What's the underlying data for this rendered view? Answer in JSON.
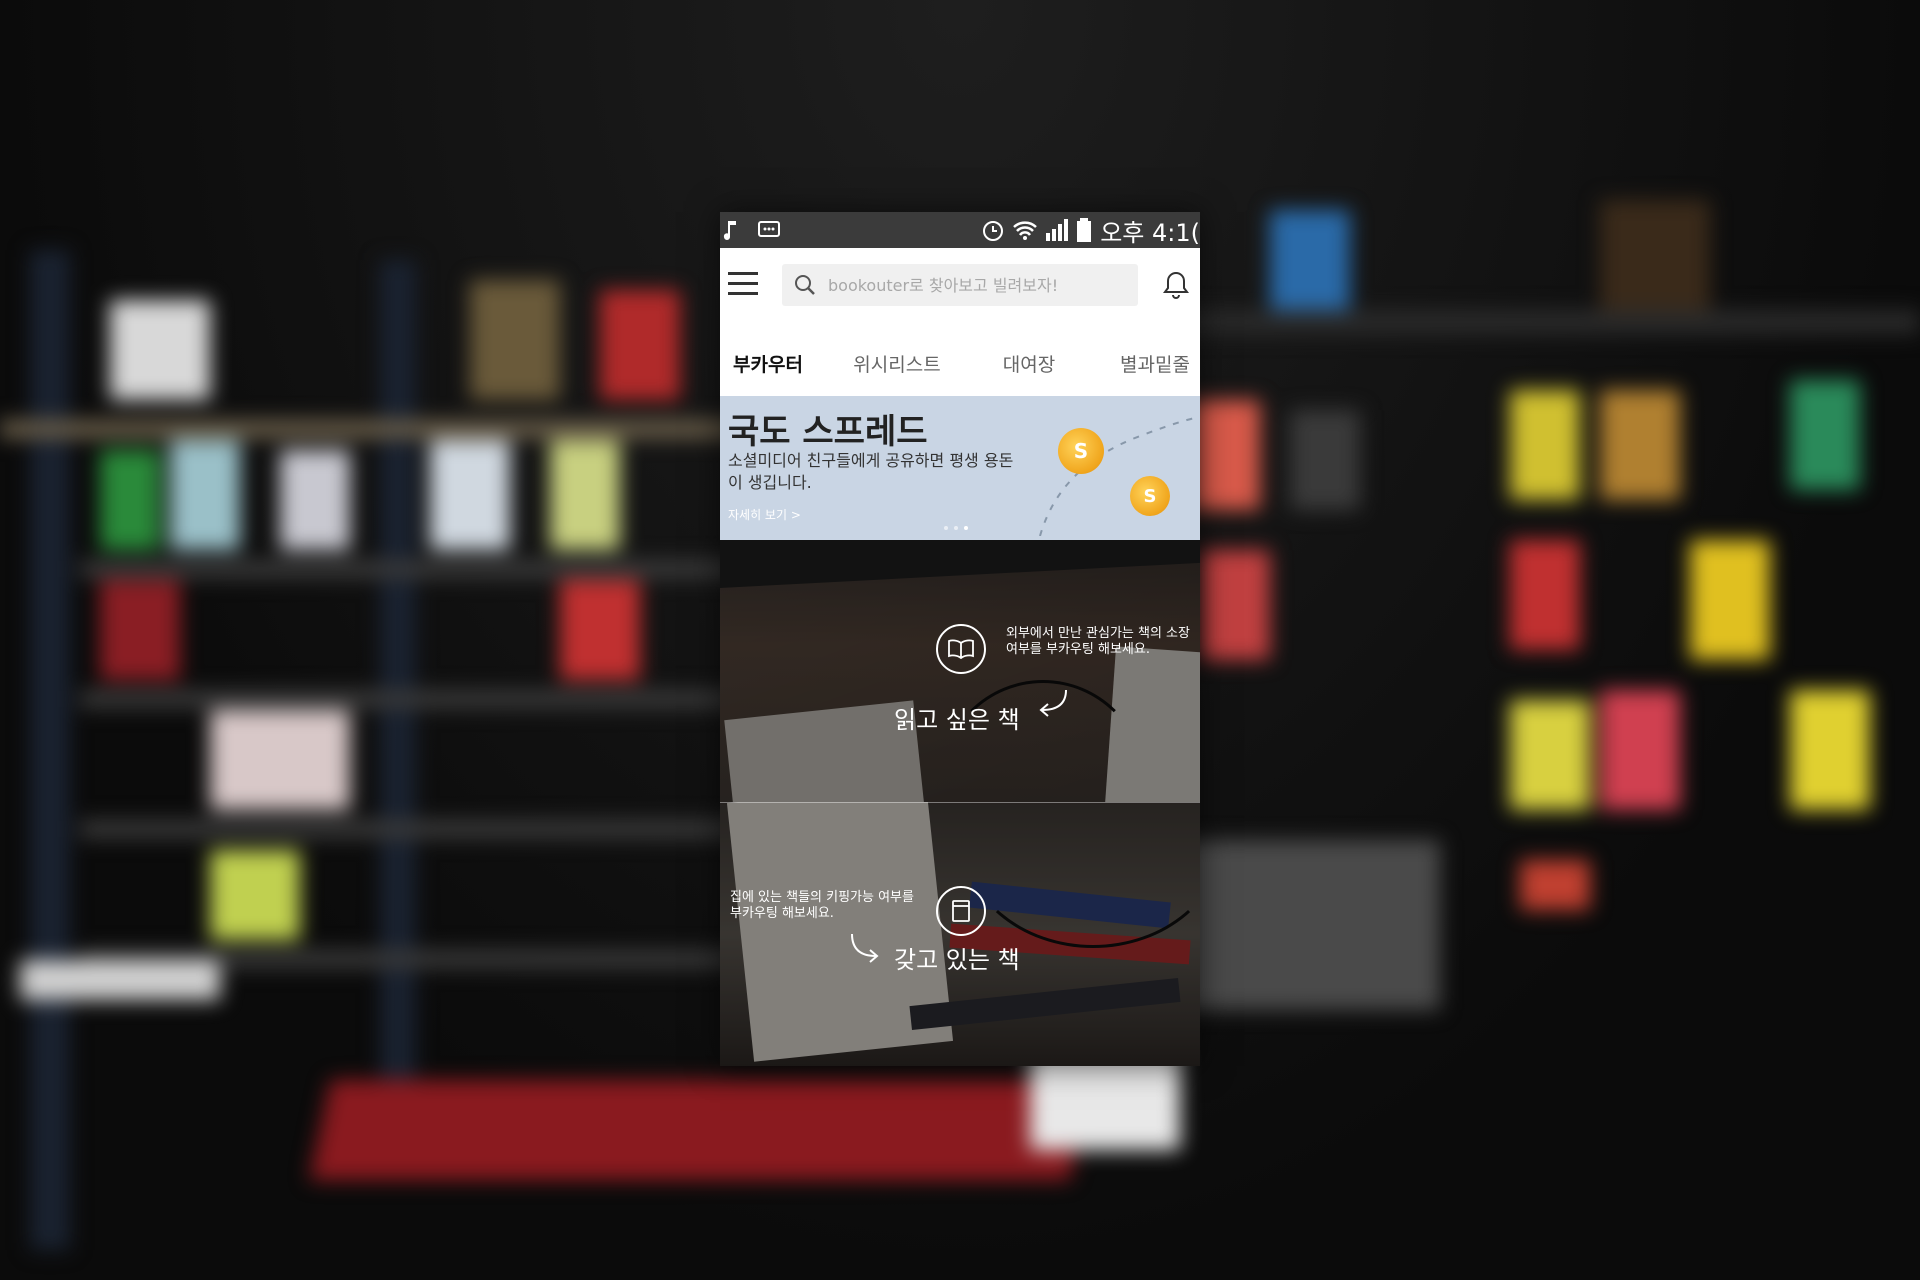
{
  "statusbar": {
    "left_icons": [
      "music-note-icon",
      "message-icon"
    ],
    "right_icons": [
      "alarm-icon",
      "wifi-icon",
      "signal-icon",
      "battery-icon"
    ],
    "clock": "오후 4:1("
  },
  "search": {
    "placeholder": "bookouter로 찾아보고 빌려보자!"
  },
  "tabs": [
    {
      "label": "부카우터",
      "active": true
    },
    {
      "label": "위시리스트",
      "active": false
    },
    {
      "label": "대여장",
      "active": false
    },
    {
      "label": "별과밑줄",
      "active": false
    }
  ],
  "banner": {
    "title": "국도 스프레드",
    "description": "소셜미디어 친구들에게 공유하면 평생 용돈이 생깁니다.",
    "link": "자세히 보기 >",
    "coin_label": "S",
    "dots": 3,
    "active_dot": 2,
    "background": "#c9d5e4"
  },
  "want_section": {
    "description": "외부에서 만난 관심가는 책의 소장여부를 부카우팅 해보세요.",
    "title": "읽고 싶은 책",
    "icon": "open-book-icon"
  },
  "own_section": {
    "description": "집에 있는 책들의 키핑가능 여부를 부카우팅 해보세요.",
    "title": "갖고 있는 책",
    "icon": "closed-book-icon"
  }
}
